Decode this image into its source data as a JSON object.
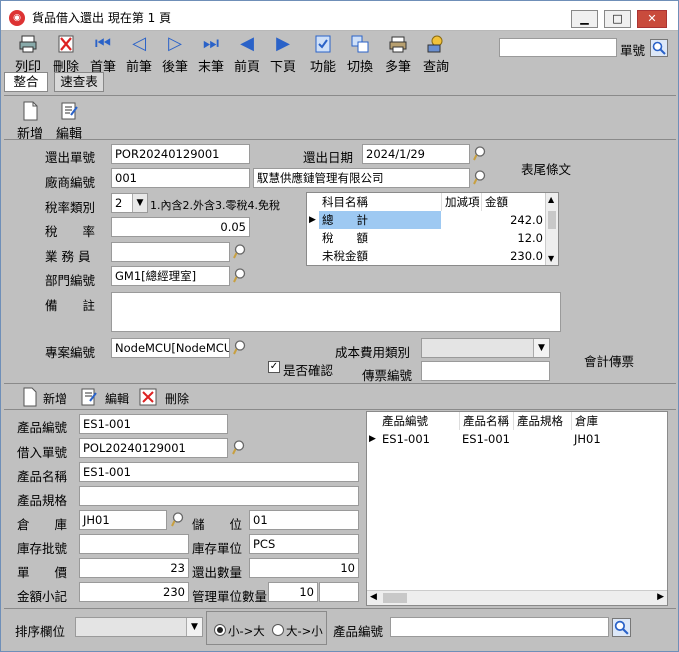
{
  "window": {
    "title": "貨品借入還出 現在第 1 頁",
    "minimize": "▁",
    "maximize": "□",
    "close": "✕"
  },
  "toolbar": {
    "items": [
      "列印",
      "刪除",
      "首筆",
      "前筆",
      "後筆",
      "末筆",
      "前頁",
      "下頁",
      "功能",
      "切換",
      "多筆",
      "查詢"
    ],
    "search_label": "單號",
    "search_value": ""
  },
  "tabs": [
    "整合",
    "速查表"
  ],
  "header_actions": {
    "add": "新增",
    "edit": "編輯"
  },
  "form": {
    "return_no_label": "還出單號",
    "return_no": "POR20240129001",
    "return_date_label": "還出日期",
    "return_date": "2024/1/29",
    "footer_text_label": "表尾條文",
    "vendor_label": "廠商編號",
    "vendor_code": "001",
    "vendor_name": "馭慧供應鏈管理有限公司",
    "tax_type_label": "稅率類別",
    "tax_type": "2",
    "tax_type_options": "1.內含2.外含3.零稅4.免稅",
    "tax_rate_label": "稅　　率",
    "tax_rate": "0.05",
    "sales_label": "業 務 員",
    "sales": "",
    "dept_label": "部門編號",
    "dept": "GM1[總經理室]",
    "remark_label": "備　　註",
    "remark": "",
    "project_label": "專案編號",
    "project": "NodeMCU[NodeMCU專案]",
    "confirm_label": "是否確認",
    "cost_type_label": "成本費用類別",
    "cost_type": "",
    "voucher_no_label": "傳票編號",
    "voucher_no": "",
    "accounting_voucher_label": "會計傳票"
  },
  "summary_grid": {
    "headers": [
      "科目名稱",
      "加減項",
      "金額"
    ],
    "rows": [
      {
        "name": "總　　計",
        "adj": "",
        "amount": "242.0"
      },
      {
        "name": "稅　　額",
        "adj": "",
        "amount": "12.0"
      },
      {
        "name": "未稅金額",
        "adj": "",
        "amount": "230.0"
      }
    ]
  },
  "detail_actions": {
    "add": "新增",
    "edit": "編輯",
    "delete": "刪除"
  },
  "detail": {
    "product_code_label": "產品編號",
    "product_code": "ES1-001",
    "borrow_no_label": "借入單號",
    "borrow_no": "POL20240129001",
    "product_name_label": "產品名稱",
    "product_name": "ES1-001",
    "product_spec_label": "產品規格",
    "product_spec": "",
    "warehouse_label": "倉　　庫",
    "warehouse": "JH01",
    "location_label": "儲　　位",
    "location": "01",
    "batch_label": "庫存批號",
    "batch": "",
    "stock_unit_label": "庫存單位",
    "stock_unit": "PCS",
    "price_label": "單　　價",
    "price": "23",
    "qty_label": "還出數量",
    "qty": "10",
    "subtotal_label": "金額小記",
    "subtotal": "230",
    "mgmt_qty_label": "管理單位數量",
    "mgmt_qty": "10"
  },
  "detail_grid": {
    "headers": [
      "產品編號",
      "產品名稱",
      "產品規格",
      "倉庫"
    ],
    "rows": [
      {
        "code": "ES1-001",
        "name": "ES1-001",
        "spec": "",
        "wh": "JH01"
      }
    ]
  },
  "bottom": {
    "sort_label": "排序欄位",
    "sort_value": "",
    "asc_label": "小->大",
    "desc_label": "大->小",
    "product_code_label": "產品編號",
    "product_code": ""
  },
  "colors": {
    "window_bg": "#c0c0c0",
    "selected_row": "#9ec9f2",
    "close_button": "#c94b3c"
  }
}
